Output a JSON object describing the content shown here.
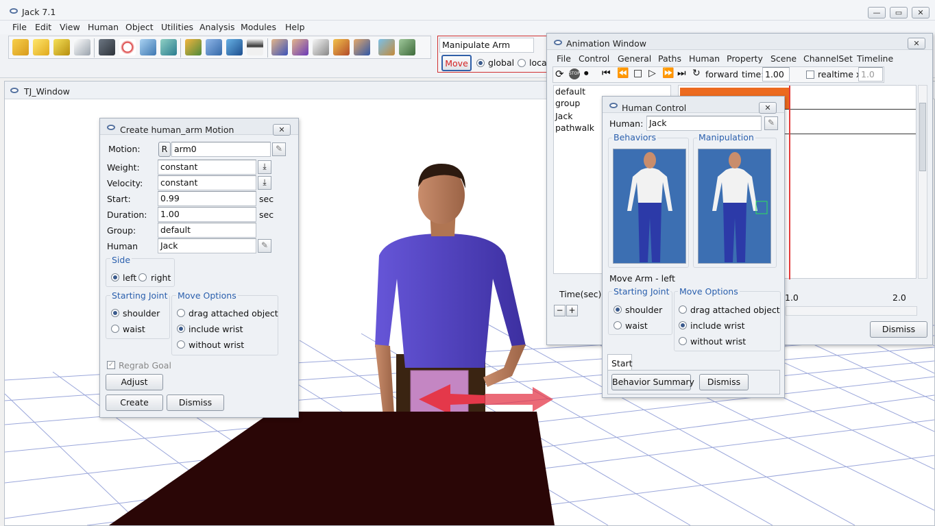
{
  "app": {
    "title": "Jack 7.1"
  },
  "menu": [
    "File",
    "Edit",
    "View",
    "Human",
    "Object",
    "Utilities",
    "Analysis",
    "Modules",
    "Help"
  ],
  "manip": {
    "mode": "Manipulate Arm",
    "move_label": "Move",
    "global_label": "global",
    "local_label": "loca"
  },
  "tj_window": {
    "title": "TJ_Window"
  },
  "create_motion": {
    "title": "Create human_arm Motion",
    "motion_label": "Motion:",
    "r_label": "R",
    "motion_value": "arm0",
    "weight_label": "Weight:",
    "weight_value": "constant",
    "velocity_label": "Velocity:",
    "velocity_value": "constant",
    "start_label": "Start:",
    "start_value": "0.99",
    "start_unit": "sec",
    "duration_label": "Duration:",
    "duration_value": "1.00",
    "duration_unit": "sec",
    "group_label": "Group:",
    "group_value": "default",
    "human_label": "Human",
    "human_value": "Jack",
    "side_title": "Side",
    "side_left": "left",
    "side_right": "right",
    "sj_title": "Starting Joint",
    "sj_shoulder": "shoulder",
    "sj_waist": "waist",
    "mo_title": "Move Options",
    "mo_drag": "drag attached object",
    "mo_include": "include wrist",
    "mo_without": "without wrist",
    "regrab": "Regrab Goal",
    "adjust": "Adjust",
    "create": "Create",
    "dismiss": "Dismiss"
  },
  "animation": {
    "title": "Animation Window",
    "menu": [
      "File",
      "Control",
      "General",
      "Paths",
      "Human",
      "Property",
      "Scene",
      "ChannelSet",
      "Timeline"
    ],
    "forward": "forward",
    "time_label": "time:",
    "time_value": "1.00",
    "realtime": "realtime x",
    "realtime_value": "1.0",
    "list": [
      "default",
      "group",
      "Jack",
      "pathwalk"
    ],
    "time_sec": "Time(sec):",
    "tick1": "1.0",
    "tick2": "2.0",
    "dismiss": "Dismiss"
  },
  "human_control": {
    "title": "Human Control",
    "human_label": "Human:",
    "human_value": "Jack",
    "behaviors": "Behaviors",
    "manipulation": "Manipulation",
    "move_arm": "Move Arm - left",
    "sj_title": "Starting Joint",
    "sj_shoulder": "shoulder",
    "sj_waist": "waist",
    "mo_title": "Move Options",
    "mo_drag": "drag attached object",
    "mo_include": "include wrist",
    "mo_without": "without wrist",
    "start_tab": "Start",
    "behavior_summary": "Behavior Summary",
    "dismiss": "Dismiss"
  },
  "colors": {
    "timeline_bar": "#ec6a1f",
    "manip_border": "#d03030",
    "figure_bg": "#3c6fb2",
    "shirt": "#5848c8",
    "table": "#2a0606",
    "box": "#c486c3"
  }
}
